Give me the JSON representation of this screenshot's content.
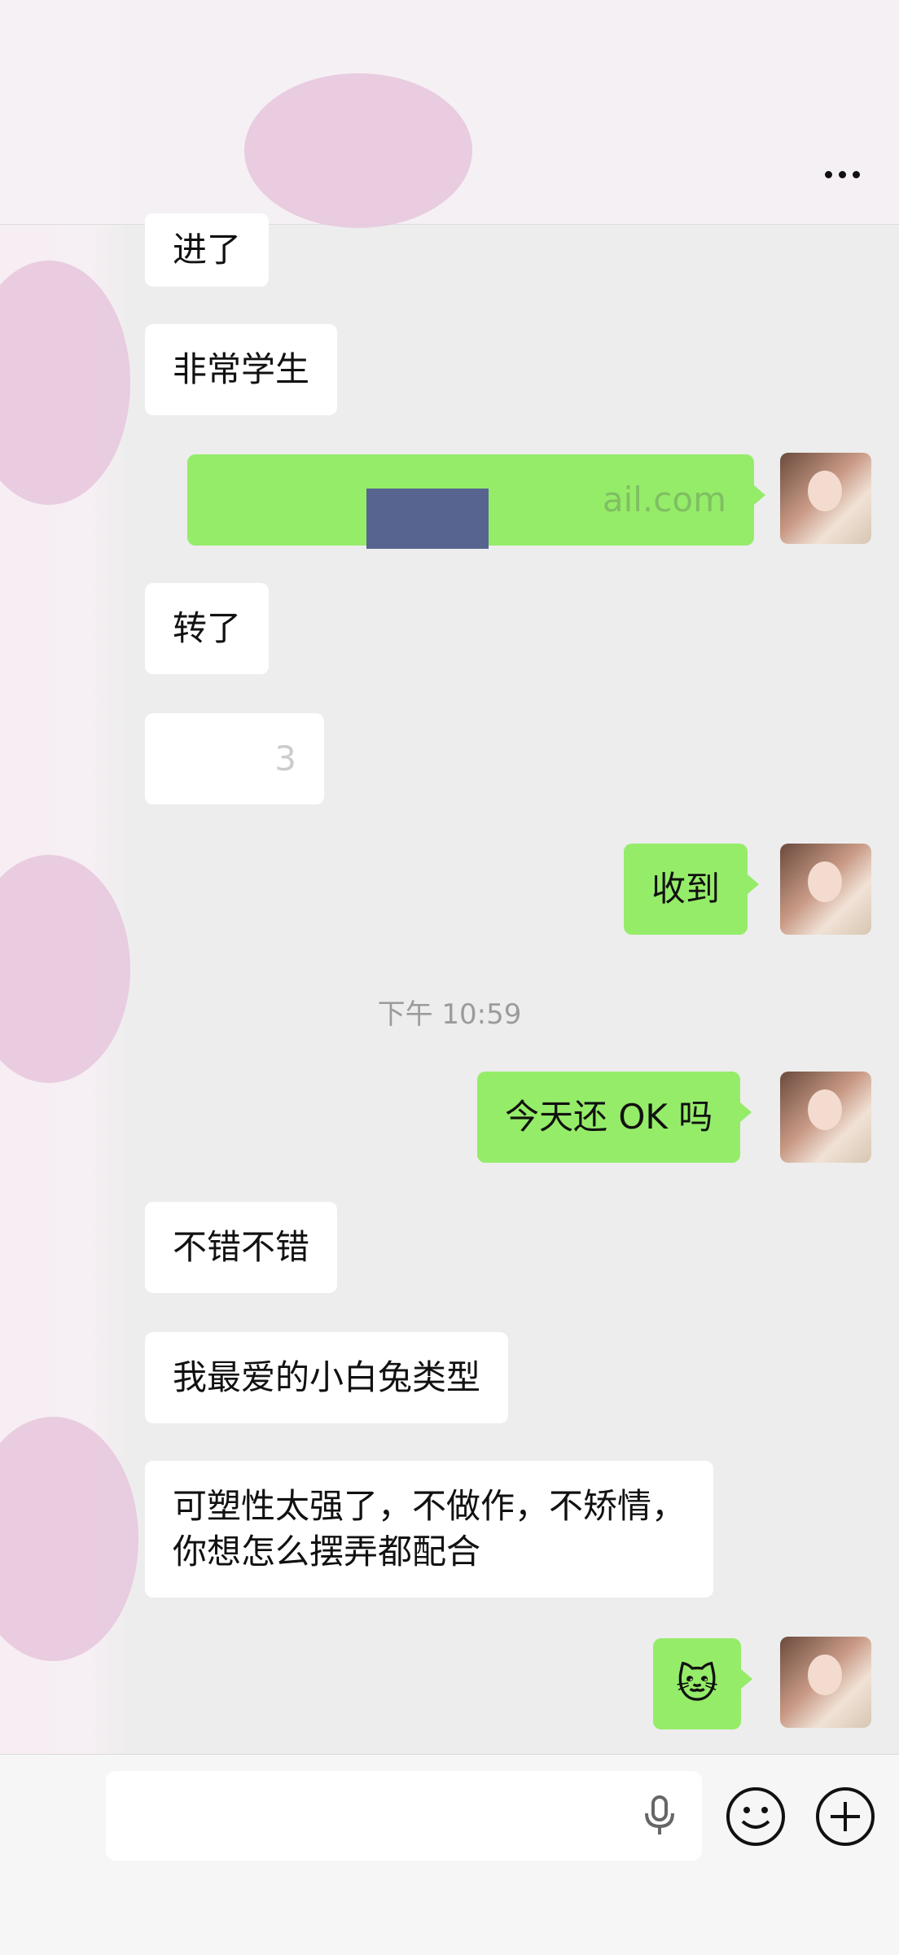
{
  "header": {
    "more_label": "more"
  },
  "messages": [
    {
      "side": "left",
      "text": "进了"
    },
    {
      "side": "left",
      "text": "非常学生"
    },
    {
      "side": "right",
      "text": "ail.com"
    },
    {
      "side": "left",
      "text": "转了"
    },
    {
      "side": "left",
      "text": "3"
    },
    {
      "side": "right",
      "text": "收到"
    },
    {
      "side": "right",
      "text": "今天还 OK 吗"
    },
    {
      "side": "left",
      "text": "不错不错"
    },
    {
      "side": "left",
      "text": "我最爱的小白兔类型"
    },
    {
      "side": "left",
      "line1": "可塑性太强了，不做作，不矫情，",
      "line2": "你想怎么摆弄都配合"
    },
    {
      "side": "right",
      "text": "🐱"
    }
  ],
  "timestamp": "下午 10:59",
  "input": {
    "placeholder": ""
  },
  "icons": {
    "more": "more-icon",
    "mic": "mic-icon",
    "emoji": "emoji-icon",
    "plus": "plus-icon"
  },
  "colors": {
    "outgoing": "#95ec69",
    "incoming": "#ffffff",
    "background": "#ededed"
  }
}
